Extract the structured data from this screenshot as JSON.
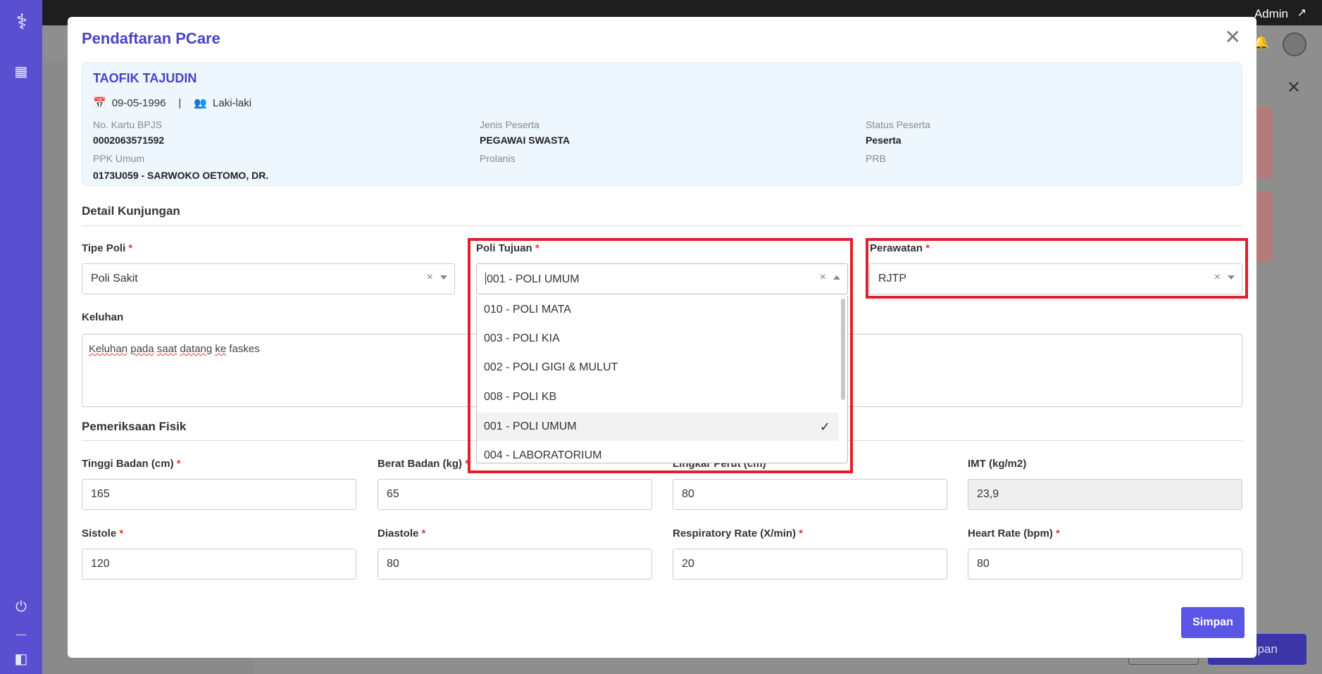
{
  "topbar": {
    "user": "Admin"
  },
  "modal": {
    "title": "Pendaftaran PCare",
    "patient": {
      "name": "TAOFIK TAJUDIN",
      "dob": "09-05-1996",
      "separator": "|",
      "gender": "Laki-laki",
      "fields": {
        "no_kartu_label": "No. Kartu BPJS",
        "no_kartu_value": "0002063571592",
        "jenis_label": "Jenis Peserta",
        "jenis_value": "PEGAWAI SWASTA",
        "status_label": "Status Peserta",
        "status_value": "Peserta",
        "ppk_label": "PPK Umum",
        "ppk_value": "0173U059 - SARWOKO OETOMO, DR.",
        "prolanis_label": "Prolanis",
        "prb_label": "PRB"
      }
    },
    "detail_section": "Detail Kunjungan",
    "tipe_poli": {
      "label": "Tipe Poli",
      "value": "Poli Sakit"
    },
    "poli_tujuan": {
      "label": "Poli Tujuan",
      "value": "001 - POLI UMUM",
      "options": [
        {
          "label": "010 - POLI MATA",
          "selected": false
        },
        {
          "label": "003 - POLI KIA",
          "selected": false
        },
        {
          "label": "002 - POLI GIGI & MULUT",
          "selected": false
        },
        {
          "label": "008 - POLI KB",
          "selected": false
        },
        {
          "label": "001 - POLI UMUM",
          "selected": true
        },
        {
          "label": "004 - LABORATORIUM",
          "selected": false
        }
      ]
    },
    "perawatan": {
      "label": "Perawatan",
      "value": "RJTP"
    },
    "keluhan": {
      "label": "Keluhan",
      "prefix": "Keluhan",
      "space": " ",
      "w1": "pada",
      "w2": "saat",
      "w3": "datang",
      "w4": "ke",
      "suffix": " faskes"
    },
    "fisik_section": "Pemeriksaan Fisik",
    "tinggi": {
      "label": "Tinggi Badan (cm)",
      "value": "165"
    },
    "berat": {
      "label": "Berat Badan (kg)",
      "value": "65"
    },
    "lingkar": {
      "label": "Lingkar Perut (cm)",
      "value": "80"
    },
    "imt": {
      "label": "IMT (kg/m2)",
      "value": "23,9"
    },
    "sistole": {
      "label": "Sistole",
      "value": "120"
    },
    "diastole": {
      "label": "Diastole",
      "value": "80"
    },
    "resp": {
      "label": "Respiratory Rate (X/min)",
      "value": "20"
    },
    "heart": {
      "label": "Heart Rate (bpm)",
      "value": "80"
    },
    "save_label": "Simpan"
  },
  "background": {
    "save_label": "Simpan"
  },
  "colors": {
    "accent": "#5b55e6",
    "sidebar": "#5b4fd1",
    "highlight": "#e0202c"
  },
  "icons": {
    "close": "close-icon",
    "calendar": "calendar-icon",
    "gender": "people-icon",
    "check": "check-icon"
  }
}
